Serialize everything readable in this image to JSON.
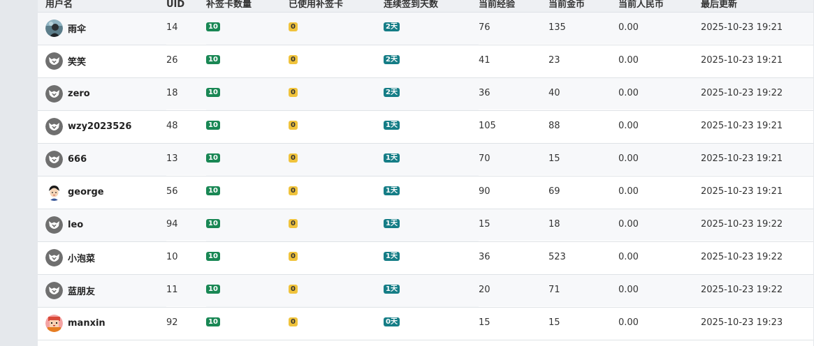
{
  "colors": {
    "makeup_badge": "#198754",
    "used_badge": "#f0c33c",
    "streak_badge": "#157d86"
  },
  "table": {
    "headers": {
      "username": "用户名",
      "uid": "UID",
      "makeup_cards": "补签卡数量",
      "used_cards": "已使用补签卡",
      "streak_days": "连续签到天数",
      "current_exp": "当前经验",
      "current_gold": "当前金币",
      "current_rmb": "当前人民币",
      "last_updated": "最后更新"
    },
    "rows": [
      {
        "avatar": "photo-avatar-icon",
        "username": "雨伞",
        "uid": "14",
        "makeup": "10",
        "used": "0",
        "streak": "2天",
        "exp": "76",
        "gold": "135",
        "rmb": "0.00",
        "updated": "2025-10-23 19:21"
      },
      {
        "avatar": "default-avatar-icon",
        "username": "笑笑",
        "uid": "26",
        "makeup": "10",
        "used": "0",
        "streak": "2天",
        "exp": "41",
        "gold": "23",
        "rmb": "0.00",
        "updated": "2025-10-23 19:21"
      },
      {
        "avatar": "default-avatar-icon",
        "username": "zero",
        "uid": "18",
        "makeup": "10",
        "used": "0",
        "streak": "2天",
        "exp": "36",
        "gold": "40",
        "rmb": "0.00",
        "updated": "2025-10-23 19:22"
      },
      {
        "avatar": "default-avatar-icon",
        "username": "wzy2023526",
        "uid": "48",
        "makeup": "10",
        "used": "0",
        "streak": "1天",
        "exp": "105",
        "gold": "88",
        "rmb": "0.00",
        "updated": "2025-10-23 19:21"
      },
      {
        "avatar": "default-avatar-icon",
        "username": "666",
        "uid": "13",
        "makeup": "10",
        "used": "0",
        "streak": "1天",
        "exp": "70",
        "gold": "15",
        "rmb": "0.00",
        "updated": "2025-10-23 19:21"
      },
      {
        "avatar": "cartoon-avatar-icon",
        "username": "george",
        "uid": "56",
        "makeup": "10",
        "used": "0",
        "streak": "1天",
        "exp": "90",
        "gold": "69",
        "rmb": "0.00",
        "updated": "2025-10-23 19:21"
      },
      {
        "avatar": "default-avatar-icon",
        "username": "leo",
        "uid": "94",
        "makeup": "10",
        "used": "0",
        "streak": "1天",
        "exp": "15",
        "gold": "18",
        "rmb": "0.00",
        "updated": "2025-10-23 19:22"
      },
      {
        "avatar": "default-avatar-icon",
        "username": "小泡菜",
        "uid": "10",
        "makeup": "10",
        "used": "0",
        "streak": "1天",
        "exp": "36",
        "gold": "523",
        "rmb": "0.00",
        "updated": "2025-10-23 19:22"
      },
      {
        "avatar": "default-avatar-icon",
        "username": "蓝朋友",
        "uid": "11",
        "makeup": "10",
        "used": "0",
        "streak": "1天",
        "exp": "20",
        "gold": "71",
        "rmb": "0.00",
        "updated": "2025-10-23 19:22"
      },
      {
        "avatar": "pixel-avatar-icon",
        "username": "manxin",
        "uid": "92",
        "makeup": "10",
        "used": "0",
        "streak": "0天",
        "exp": "15",
        "gold": "15",
        "rmb": "0.00",
        "updated": "2025-10-23 19:23"
      }
    ]
  }
}
